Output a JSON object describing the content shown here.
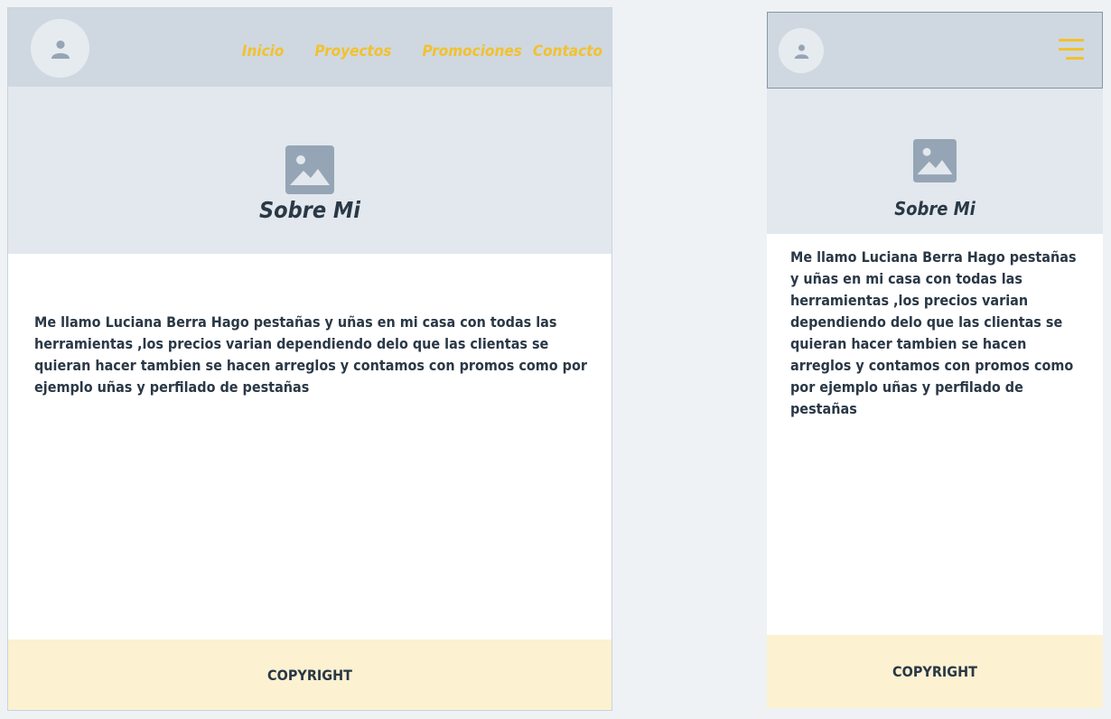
{
  "desktop": {
    "nav": {
      "items": [
        "Inicio",
        "Proyectos",
        "Promociones",
        "Contacto"
      ]
    },
    "hero": {
      "title": "Sobre Mi"
    },
    "body": "Me llamo Luciana Berra Hago pestañas y uñas en mi casa con todas las herramientas ,los precios varian dependiendo delo que las clientas se quieran hacer tambien se hacen arreglos y contamos con promos como por ejemplo uñas y perfilado de pestañas",
    "footer": "COPYRIGHT"
  },
  "mobile": {
    "hero": {
      "title": "Sobre Mi"
    },
    "body": "Me llamo Luciana Berra Hago pestañas y uñas en mi casa con todas las herramientas ,los precios varian dependiendo delo que las clientas se quieran hacer tambien se hacen arreglos y contamos con promos como por ejemplo uñas y perfilado de pestañas",
    "footer": "COPYRIGHT"
  },
  "icons": {
    "avatar": "user-icon",
    "hero_image": "image-placeholder-icon",
    "menu": "hamburger-menu-icon"
  },
  "colors": {
    "accent": "#f2c12e",
    "header_bg": "#cfd8e1",
    "hero_bg": "#e2e8ed",
    "footer_bg": "#fcf1d1",
    "text": "#2a3846"
  }
}
